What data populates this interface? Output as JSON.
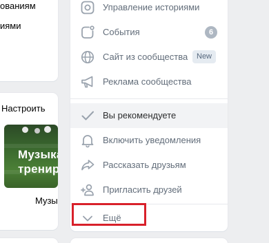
{
  "left_panel": {
    "top_card": {
      "line1": "ованиям",
      "line2": "иями"
    },
    "recommend_card": {
      "configure_link": "Настроить",
      "thumb_text_line1": "Музыка",
      "thumb_text_line2": "тренир",
      "caption": "Музы"
    }
  },
  "menu": {
    "items": [
      {
        "label": "Управление историями",
        "icon": "stories-icon"
      },
      {
        "label": "События",
        "icon": "events-icon",
        "badge": "6"
      },
      {
        "label": "Сайт из сообщества",
        "icon": "globe-icon",
        "tag": "New"
      },
      {
        "label": "Реклама сообщества",
        "icon": "megaphone-icon"
      },
      {
        "label": "Вы рекомендуете",
        "icon": "check-icon",
        "selected": true
      },
      {
        "label": "Включить уведомления",
        "icon": "bell-icon"
      },
      {
        "label": "Рассказать друзьям",
        "icon": "share-icon"
      },
      {
        "label": "Пригласить друзей",
        "icon": "add-user-icon"
      },
      {
        "label": "Ещё",
        "icon": "chevron-down-icon"
      }
    ]
  },
  "colors": {
    "icon": "#99a2ad",
    "label": "#626d7a",
    "selected_bg": "#f2f3f5",
    "highlight_border": "#d8202a"
  }
}
